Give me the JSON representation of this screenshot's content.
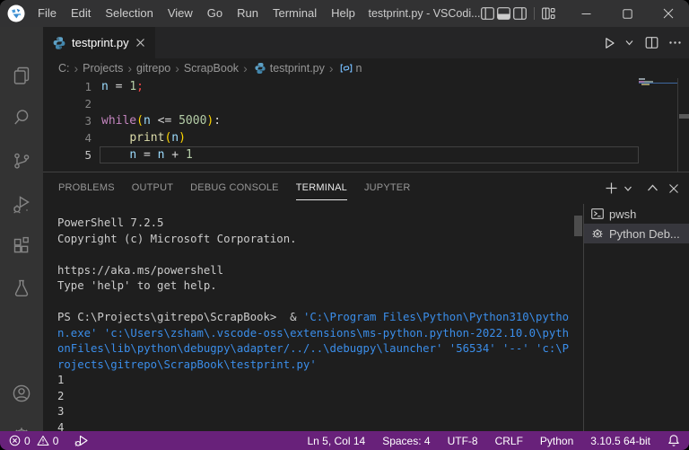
{
  "colors": {
    "var": "#9cdcfe",
    "op": "#d4d4d4",
    "num": "#b5cea8",
    "invalid": "#f44747",
    "keyword": "#c586c0",
    "func": "#dcdcaa",
    "paren": "#ffd700",
    "term_fg": "#cccccc",
    "term_blue": "#3b8eea",
    "statusbar_bg": "#68217a",
    "titlebar_bg": "#323233",
    "activitybar_bg": "#333333",
    "editor_bg": "#1e1e1e",
    "tabbar_bg": "#252526",
    "list_selected_bg": "#37373d"
  },
  "titlebar": {
    "title": "testprint.py - VSCodi...",
    "menus": [
      "File",
      "Edit",
      "Selection",
      "View",
      "Go",
      "Run",
      "Terminal",
      "Help"
    ]
  },
  "tabbar": {
    "active_tab": {
      "label": "testprint.py"
    }
  },
  "breadcrumbs": {
    "items": [
      "C:",
      "Projects",
      "gitrepo",
      "ScrapBook"
    ],
    "file": "testprint.py",
    "symbol": "n"
  },
  "editor": {
    "line_numbers": [
      "1",
      "2",
      "3",
      "4",
      "5"
    ],
    "lines": [
      {
        "tokens": [
          {
            "t": "n",
            "c": "var"
          },
          {
            "t": " = ",
            "c": "op"
          },
          {
            "t": "1",
            "c": "num"
          },
          {
            "t": ";",
            "c": "invalid"
          }
        ]
      },
      {
        "tokens": []
      },
      {
        "tokens": [
          {
            "t": "while",
            "c": "keyword"
          },
          {
            "t": "(",
            "c": "paren"
          },
          {
            "t": "n",
            "c": "var"
          },
          {
            "t": " <= ",
            "c": "op"
          },
          {
            "t": "5000",
            "c": "num"
          },
          {
            "t": ")",
            "c": "paren"
          },
          {
            "t": ":",
            "c": "op"
          }
        ]
      },
      {
        "tokens": [
          {
            "t": "    ",
            "c": "op"
          },
          {
            "t": "print",
            "c": "func"
          },
          {
            "t": "(",
            "c": "paren"
          },
          {
            "t": "n",
            "c": "var"
          },
          {
            "t": ")",
            "c": "paren"
          }
        ]
      },
      {
        "tokens": [
          {
            "t": "    ",
            "c": "op"
          },
          {
            "t": "n",
            "c": "var"
          },
          {
            "t": " = ",
            "c": "op"
          },
          {
            "t": "n",
            "c": "var"
          },
          {
            "t": " + ",
            "c": "op"
          },
          {
            "t": "1",
            "c": "num"
          }
        ]
      }
    ],
    "cursor_position": "Ln 5, Col 14"
  },
  "panel": {
    "tabs": [
      "PROBLEMS",
      "OUTPUT",
      "DEBUG CONSOLE",
      "TERMINAL",
      "JUPYTER"
    ],
    "active_tab": "TERMINAL"
  },
  "terminal": {
    "lines": [
      {
        "segs": [
          {
            "t": "PowerShell 7.2.5",
            "c": "term_fg"
          }
        ]
      },
      {
        "segs": [
          {
            "t": "Copyright (c) Microsoft Corporation.",
            "c": "term_fg"
          }
        ]
      },
      {
        "segs": [
          {
            "t": "",
            "c": "term_fg"
          }
        ]
      },
      {
        "segs": [
          {
            "t": "https://aka.ms/powershell",
            "c": "term_fg"
          }
        ]
      },
      {
        "segs": [
          {
            "t": "Type 'help' to get help.",
            "c": "term_fg"
          }
        ]
      },
      {
        "segs": [
          {
            "t": "",
            "c": "term_fg"
          }
        ]
      },
      {
        "segs": [
          {
            "t": "PS C:\\Projects\\gitrepo\\ScrapBook>  & ",
            "c": "term_fg"
          },
          {
            "t": "'C:\\Program Files\\Python\\Python310\\pytho",
            "c": "term_blue"
          }
        ]
      },
      {
        "segs": [
          {
            "t": "n.exe' 'c:\\Users\\zsham\\.vscode-oss\\extensions\\ms-python.python-2022.10.0\\pyth",
            "c": "term_blue"
          }
        ]
      },
      {
        "segs": [
          {
            "t": "onFiles\\lib\\python\\debugpy\\adapter/../..\\debugpy\\launcher' '56534' '--' 'c:\\P",
            "c": "term_blue"
          }
        ]
      },
      {
        "segs": [
          {
            "t": "rojects\\gitrepo\\ScrapBook\\testprint.py'",
            "c": "term_blue"
          }
        ]
      },
      {
        "segs": [
          {
            "t": "1",
            "c": "term_fg"
          }
        ]
      },
      {
        "segs": [
          {
            "t": "2",
            "c": "term_fg"
          }
        ]
      },
      {
        "segs": [
          {
            "t": "3",
            "c": "term_fg"
          }
        ]
      },
      {
        "segs": [
          {
            "t": "4",
            "c": "term_fg"
          }
        ]
      }
    ],
    "list": [
      {
        "label": "pwsh"
      },
      {
        "label": "Python Deb..."
      }
    ]
  },
  "statusbar": {
    "errors": "0",
    "warnings": "0",
    "items": [
      "Ln 5, Col 14",
      "Spaces: 4",
      "UTF-8",
      "CRLF",
      "Python",
      "3.10.5 64-bit"
    ]
  }
}
